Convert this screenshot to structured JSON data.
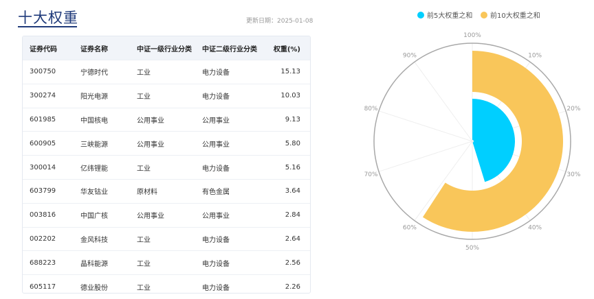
{
  "page": {
    "title": "十大权重",
    "update_date": "更新日期：2025-01-08"
  },
  "table": {
    "headers": [
      "证券代码",
      "证券名称",
      "中证一级行业分类",
      "中证二级行业分类",
      "权重(%)"
    ],
    "rows": [
      [
        "300750",
        "宁德时代",
        "工业",
        "电力设备",
        "15.13"
      ],
      [
        "300274",
        "阳光电源",
        "工业",
        "电力设备",
        "10.03"
      ],
      [
        "601985",
        "中国核电",
        "公用事业",
        "公用事业",
        "9.13"
      ],
      [
        "600905",
        "三峡能源",
        "公用事业",
        "公用事业",
        "5.80"
      ],
      [
        "300014",
        "亿纬锂能",
        "工业",
        "电力设备",
        "5.16"
      ],
      [
        "603799",
        "华友钴业",
        "原材料",
        "有色金属",
        "3.64"
      ],
      [
        "003816",
        "中国广核",
        "公用事业",
        "公用事业",
        "2.84"
      ],
      [
        "002202",
        "金风科技",
        "工业",
        "电力设备",
        "2.64"
      ],
      [
        "688223",
        "晶科能源",
        "工业",
        "电力设备",
        "2.56"
      ],
      [
        "605117",
        "德业股份",
        "工业",
        "电力设备",
        "2.26"
      ]
    ]
  },
  "chart_data": {
    "type": "polar-bar",
    "series": [
      {
        "name": "前5大权重之和",
        "value": 45.25,
        "color": "#00cfff"
      },
      {
        "name": "前10大权重之和",
        "value": 59.19,
        "color": "#f9c65a"
      }
    ],
    "angle_axis": {
      "min": 0,
      "max": 100,
      "ticks": [
        "10%",
        "20%",
        "30%",
        "40%",
        "50%",
        "60%",
        "70%",
        "80%",
        "90%",
        "100%"
      ]
    },
    "legend_position": "top-right"
  }
}
